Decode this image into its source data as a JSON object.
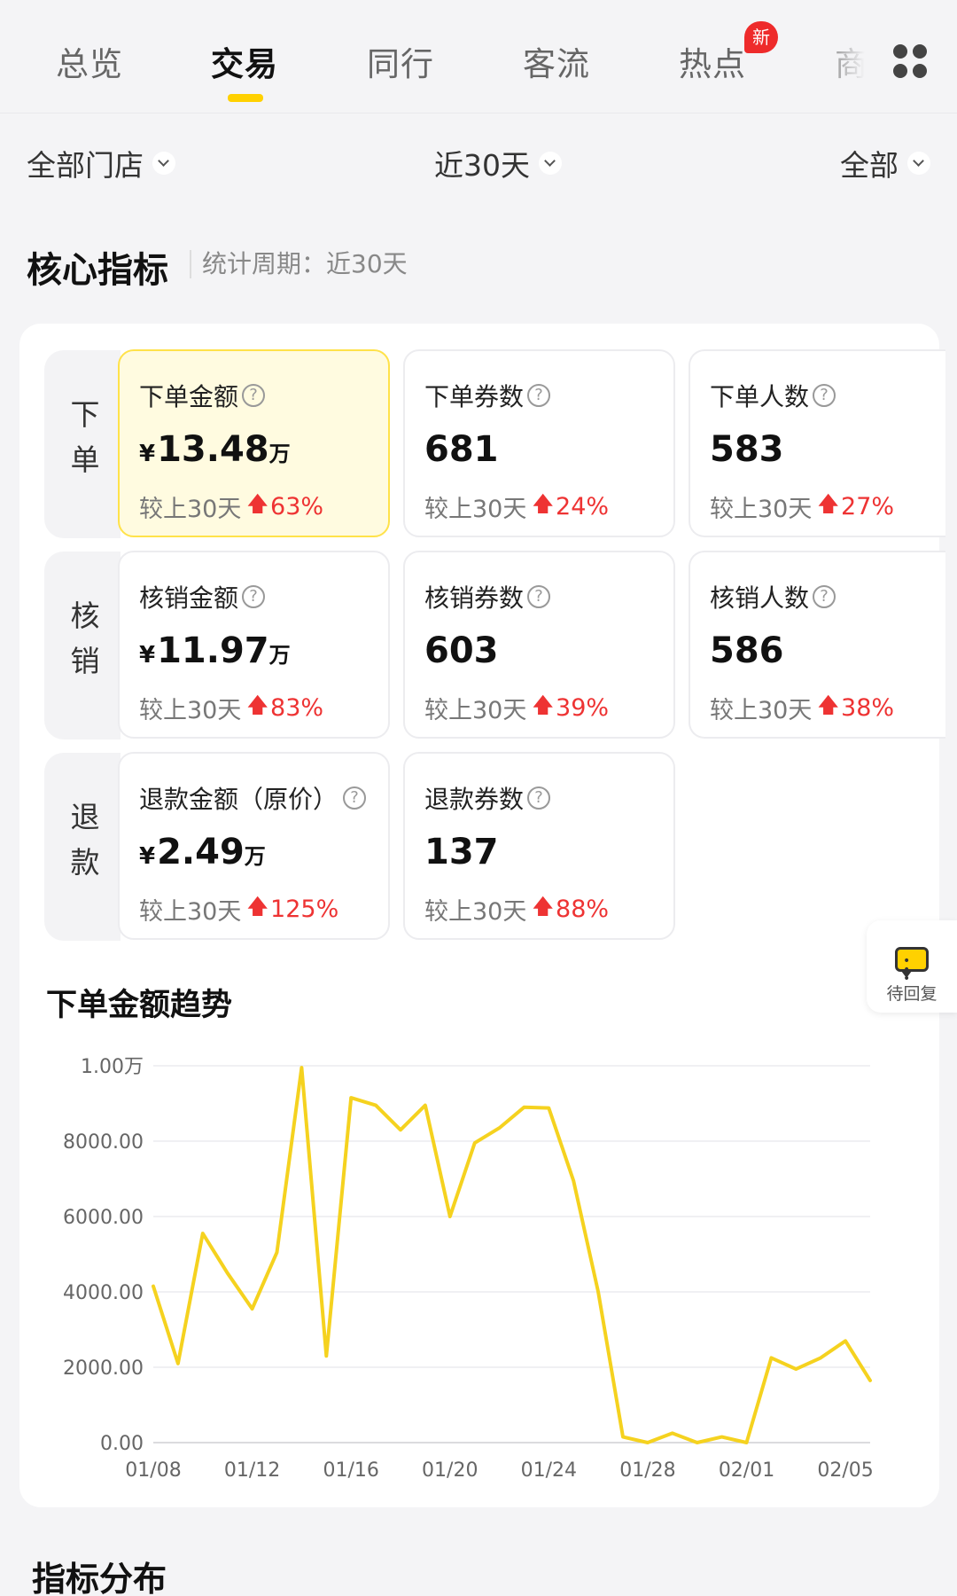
{
  "tabs": [
    {
      "label": "总览",
      "active": false
    },
    {
      "label": "交易",
      "active": true
    },
    {
      "label": "同行",
      "active": false
    },
    {
      "label": "客流",
      "active": false
    },
    {
      "label": "热点",
      "active": false,
      "badge": "新"
    },
    {
      "label": "商",
      "active": false
    }
  ],
  "filters": {
    "store": "全部门店",
    "period": "近30天",
    "scope": "全部"
  },
  "core": {
    "title": "核心指标",
    "period_label": "统计周期：近30天"
  },
  "groups": [
    {
      "label": "下单",
      "cards": [
        {
          "title": "下单金额",
          "currency": "¥",
          "value": "13.48",
          "unit": "万",
          "compare": "较上30天",
          "pct": "63%",
          "highlight": true
        },
        {
          "title": "下单券数",
          "value": "681",
          "compare": "较上30天",
          "pct": "24%"
        },
        {
          "title": "下单人数",
          "value": "583",
          "compare": "较上30天",
          "pct": "27%"
        }
      ]
    },
    {
      "label": "核销",
      "cards": [
        {
          "title": "核销金额",
          "currency": "¥",
          "value": "11.97",
          "unit": "万",
          "compare": "较上30天",
          "pct": "83%"
        },
        {
          "title": "核销券数",
          "value": "603",
          "compare": "较上30天",
          "pct": "39%"
        },
        {
          "title": "核销人数",
          "value": "586",
          "compare": "较上30天",
          "pct": "38%"
        }
      ]
    },
    {
      "label": "退款",
      "cards": [
        {
          "title": "退款金额（原价）",
          "currency": "¥",
          "value": "2.49",
          "unit": "万",
          "compare": "较上30天",
          "pct": "125%"
        },
        {
          "title": "退款券数",
          "value": "137",
          "compare": "较上30天",
          "pct": "88%"
        }
      ]
    }
  ],
  "chart_title": "下单金额趋势",
  "chart_data": {
    "type": "line",
    "title": "下单金额趋势",
    "ylim": [
      0,
      10000
    ],
    "y_ticks": [
      0,
      2000,
      4000,
      6000,
      8000,
      10000
    ],
    "y_tick_labels": [
      "0.00",
      "2000.00",
      "4000.00",
      "6000.00",
      "8000.00",
      "1.00万"
    ],
    "x_tick_labels": [
      "01/08",
      "01/12",
      "01/16",
      "01/20",
      "01/24",
      "01/28",
      "02/01",
      "02/05"
    ],
    "grid": true,
    "series": [
      {
        "color": "#f5d21f",
        "x": [
          "01/08",
          "01/09",
          "01/10",
          "01/11",
          "01/12",
          "01/13",
          "01/14",
          "01/15",
          "01/16",
          "01/17",
          "01/18",
          "01/19",
          "01/20",
          "01/21",
          "01/22",
          "01/23",
          "01/24",
          "01/25",
          "01/26",
          "01/27",
          "01/28",
          "01/29",
          "01/30",
          "01/31",
          "02/01",
          "02/02",
          "02/03",
          "02/04",
          "02/05",
          "02/06"
        ],
        "values": [
          4150,
          2100,
          5550,
          4500,
          3550,
          5050,
          9950,
          2300,
          9150,
          8950,
          8300,
          8950,
          6000,
          7950,
          8350,
          8900,
          8880,
          6950,
          4000,
          150,
          0,
          250,
          0,
          150,
          0,
          2250,
          1950,
          2250,
          2700,
          1650
        ]
      }
    ]
  },
  "float_button": {
    "label": "待回复",
    "icon": "message-icon"
  },
  "distribution_title": "指标分布",
  "colors": {
    "accent": "#ffd100",
    "up": "#ee3333",
    "line": "#f5d21f"
  }
}
